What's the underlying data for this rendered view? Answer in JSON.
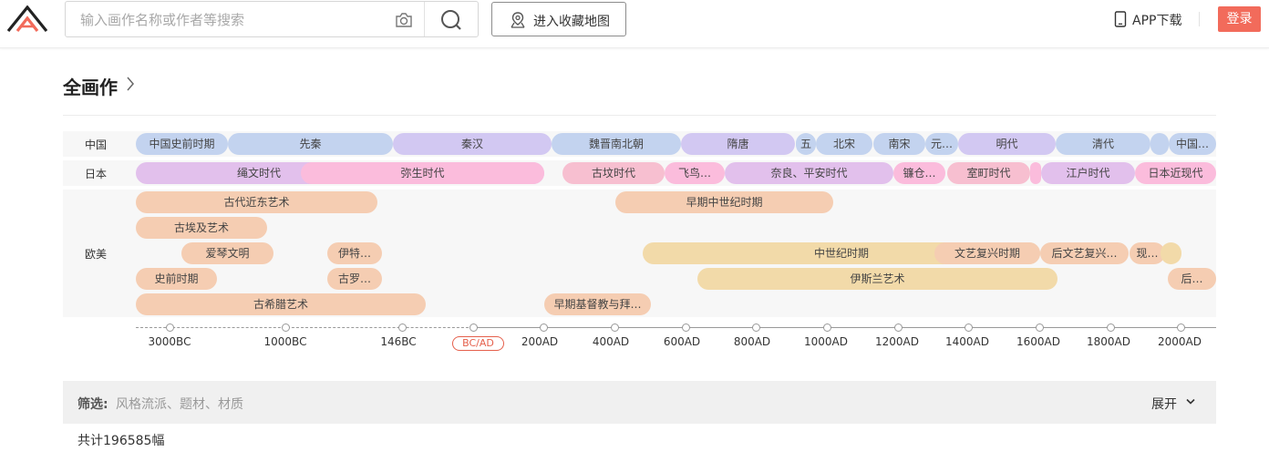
{
  "search": {
    "placeholder": "输入画作名称或作者等搜索"
  },
  "header": {
    "map_label": "进入收藏地图",
    "app_label": "APP下载",
    "login_label": "登录"
  },
  "section": {
    "title": "全画作"
  },
  "rows": {
    "china": "中国",
    "japan": "日本",
    "west": "欧美"
  },
  "china": [
    "中国史前时期",
    "先秦",
    "秦汉",
    "魏晋南北朝",
    "隋唐",
    "五",
    "北宋",
    "南宋",
    "元…",
    "明代",
    "清代",
    "",
    "中国…"
  ],
  "japan": [
    "绳文时代",
    "弥生时代",
    "古坟时代",
    "飞鸟…",
    "奈良、平安时代",
    "镰仓…",
    "室町时代",
    "",
    "江户时代",
    "日本近现代"
  ],
  "west": [
    "古代近东艺术",
    "早期中世纪时期",
    "古埃及艺术",
    "爱琴文明",
    "伊特…",
    "中世纪时期",
    "文艺复兴时期",
    "后文艺复兴…",
    "现…",
    "",
    "史前时期",
    "古罗…",
    "伊斯兰艺术",
    "后…",
    "古希腊艺术",
    "早期基督教与拜…"
  ],
  "timeline": [
    "3000BC",
    "1000BC",
    "146BC",
    "BC/AD",
    "200AD",
    "400AD",
    "600AD",
    "800AD",
    "1000AD",
    "1200AD",
    "1400AD",
    "1600AD",
    "1800AD",
    "2000AD"
  ],
  "filter": {
    "label": "筛选:",
    "options": "风格流派、题材、材质",
    "expand": "展开"
  },
  "total": "共计196585幅",
  "colors": {
    "accent": "#f26b5b",
    "china_blue": "#c3d3ef",
    "china_purple": "#d2c8f2",
    "japan_pink": "#fbbcdc",
    "japan_violet": "#e2c0ec",
    "west_peach": "#f5cdb2",
    "west_sand": "#f2daa9"
  }
}
